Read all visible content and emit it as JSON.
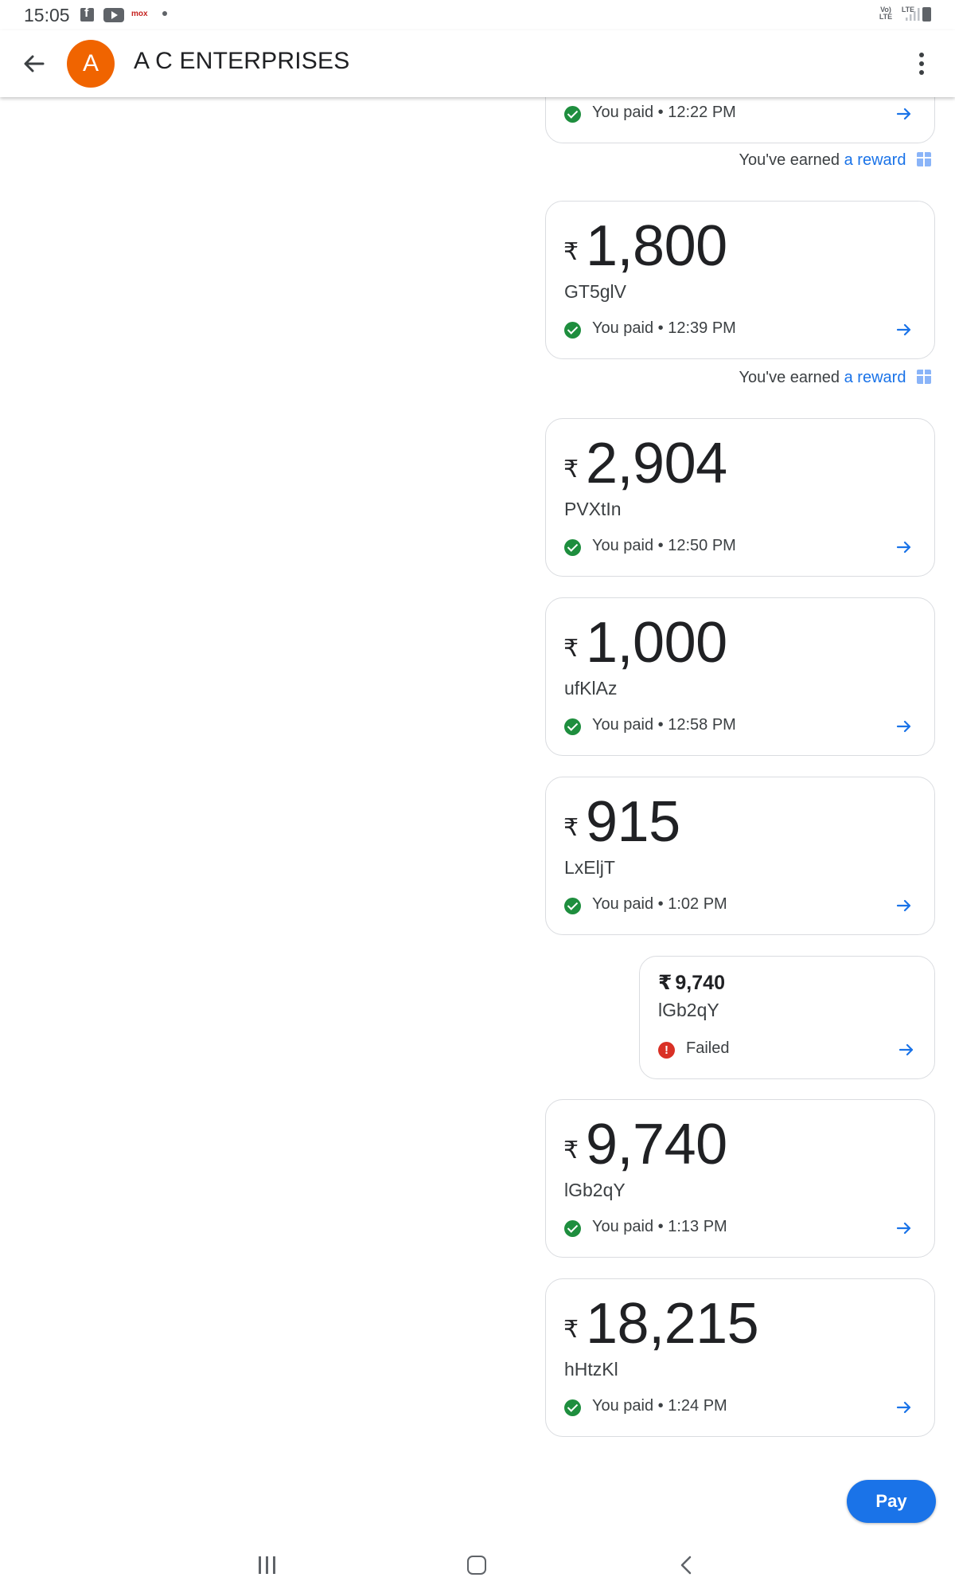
{
  "status_bar": {
    "time": "15:05",
    "app_icons": [
      "facebook-icon",
      "youtube-icon",
      "mox-icon",
      "dot-icon"
    ],
    "mox_label": "mox",
    "network_label": "Vo) LTE",
    "lte_label": "LTE"
  },
  "header": {
    "avatar_letter": "A",
    "avatar_color": "#f06400",
    "title": "A C ENTERPRISES"
  },
  "reward_text": {
    "prefix": "You've earned",
    "link": "a reward"
  },
  "transactions": [
    {
      "status": "You paid • 12:22 PM"
    },
    {
      "amount": "1,800",
      "currency": "₹",
      "note": "GT5glV",
      "status": "You paid • 12:39 PM"
    },
    {
      "amount": "2,904",
      "currency": "₹",
      "note": "PVXtIn",
      "status": "You paid • 12:50 PM"
    },
    {
      "amount": "1,000",
      "currency": "₹",
      "note": "ufKlAz",
      "status": "You paid • 12:58 PM"
    },
    {
      "amount": "915",
      "currency": "₹",
      "note": "LxElјT",
      "status": "You paid • 1:02 PM"
    },
    {
      "amount": "9,740",
      "currency": "₹",
      "note": "lGb2qY",
      "status": "Failed"
    },
    {
      "amount": "9,740",
      "currency": "₹",
      "note": "lGb2qY",
      "status": "You paid • 1:13 PM"
    },
    {
      "amount": "18,215",
      "currency": "₹",
      "note": "hHtzKl",
      "status": "You paid • 1:24 PM"
    }
  ],
  "pay_button": {
    "label": "Pay"
  },
  "colors": {
    "accent": "#1a73e8",
    "success": "#1e8e3e",
    "error": "#d93025",
    "card_border": "#dadce0"
  }
}
